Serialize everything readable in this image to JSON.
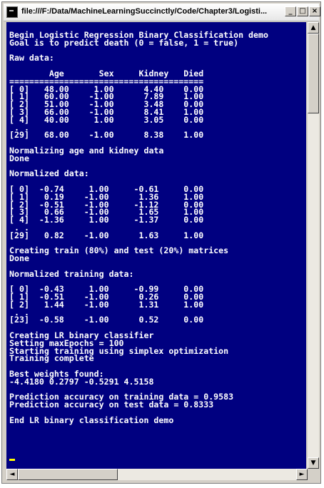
{
  "window": {
    "title": "file:///F:/Data/MachineLearningSuccinctly/Code/Chapter3/Logisti...",
    "controls": {
      "minimize": "_",
      "maximize": "□",
      "close": "×"
    }
  },
  "console": {
    "lines": [
      "Begin Logistic Regression Binary Classification demo",
      "Goal is to predict death (0 = false, 1 = true)",
      "",
      "Raw data:",
      "",
      "        Age       Sex     Kidney   Died",
      "=======================================",
      "[ 0]   48.00     1.00      4.40    0.00",
      "[ 1]   60.00    -1.00      7.89    1.00",
      "[ 2]   51.00    -1.00      3.48    0.00",
      "[ 3]   66.00    -1.00      8.41    1.00",
      "[ 4]   40.00     1.00      3.05    0.00",
      " . .",
      "[29]   68.00    -1.00      8.38    1.00",
      "",
      "Normalizing age and kidney data",
      "Done",
      "",
      "Normalized data:",
      "",
      "[ 0]  -0.74     1.00     -0.61     0.00",
      "[ 1]   0.19    -1.00      1.36     1.00",
      "[ 2]  -0.51    -1.00     -1.12     0.00",
      "[ 3]   0.66    -1.00      1.65     1.00",
      "[ 4]  -1.36     1.00     -1.37     0.00",
      " . .",
      "[29]   0.82    -1.00      1.63     1.00",
      "",
      "Creating train (80%) and test (20%) matrices",
      "Done",
      "",
      "Normalized training data:",
      "",
      "[ 0]  -0.43     1.00     -0.99     0.00",
      "[ 1]  -0.51    -1.00      0.26     0.00",
      "[ 2]   1.44    -1.00      1.31     1.00",
      " . .",
      "[23]  -0.58    -1.00      0.52     0.00",
      "",
      "Creating LR binary classifier",
      "Setting maxEpochs = 100",
      "Starting training using simplex optimization",
      "Training complete",
      "",
      "Best weights found:",
      "-4.4180 0.2797 -0.5291 4.5158",
      "",
      "Prediction accuracy on training data = 0.9583",
      "Prediction accuracy on test data = 0.8333",
      "",
      "End LR binary classification demo"
    ]
  },
  "scrollbars": {
    "up_arrow": "▲",
    "down_arrow": "▼",
    "left_arrow": "◄",
    "right_arrow": "►"
  },
  "colors": {
    "console_background": "#000080",
    "console_text": "#ffffff",
    "cursor": "#ffff00"
  }
}
